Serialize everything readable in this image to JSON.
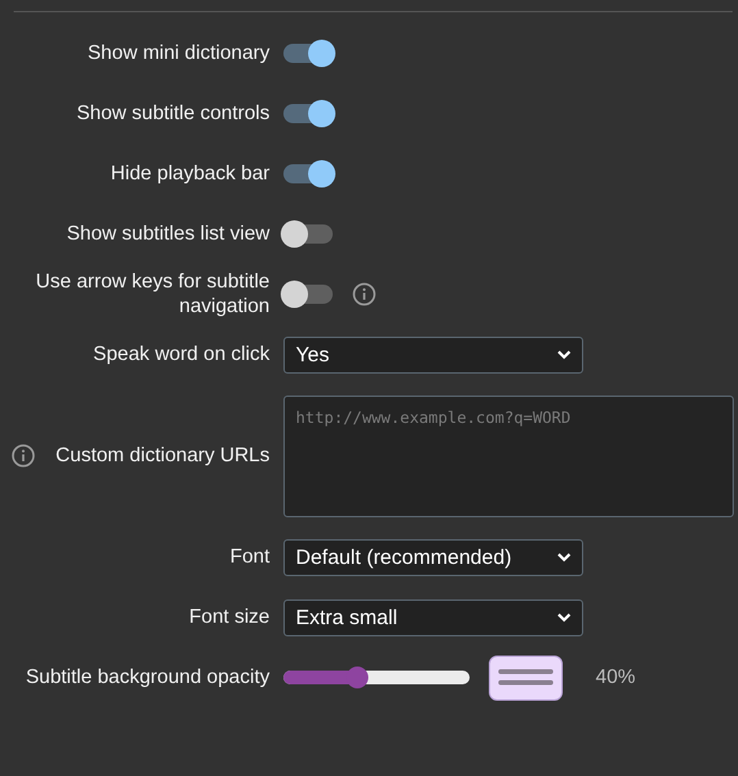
{
  "settings": [
    {
      "kind": "toggle",
      "label": "Show mini dictionary",
      "on": true
    },
    {
      "kind": "toggle",
      "label": "Show subtitle controls",
      "on": true
    },
    {
      "kind": "toggle",
      "label": "Hide playback bar",
      "on": true
    },
    {
      "kind": "toggle",
      "label": "Show subtitles list view",
      "on": false
    },
    {
      "kind": "toggle",
      "label": "Use arrow keys for subtitle navigation",
      "on": false,
      "info_after": true
    },
    {
      "kind": "select",
      "label": "Speak word on click",
      "value": "Yes"
    },
    {
      "kind": "textarea",
      "label": "Custom dictionary URLs",
      "placeholder": "http://www.example.com?q=WORD",
      "info_before": true
    },
    {
      "kind": "select",
      "label": "Font",
      "value": "Default (recommended)"
    },
    {
      "kind": "select",
      "label": "Font size",
      "value": "Extra small"
    },
    {
      "kind": "slider",
      "label": "Subtitle background opacity",
      "level": 0.4,
      "reading": "40%"
    }
  ]
}
